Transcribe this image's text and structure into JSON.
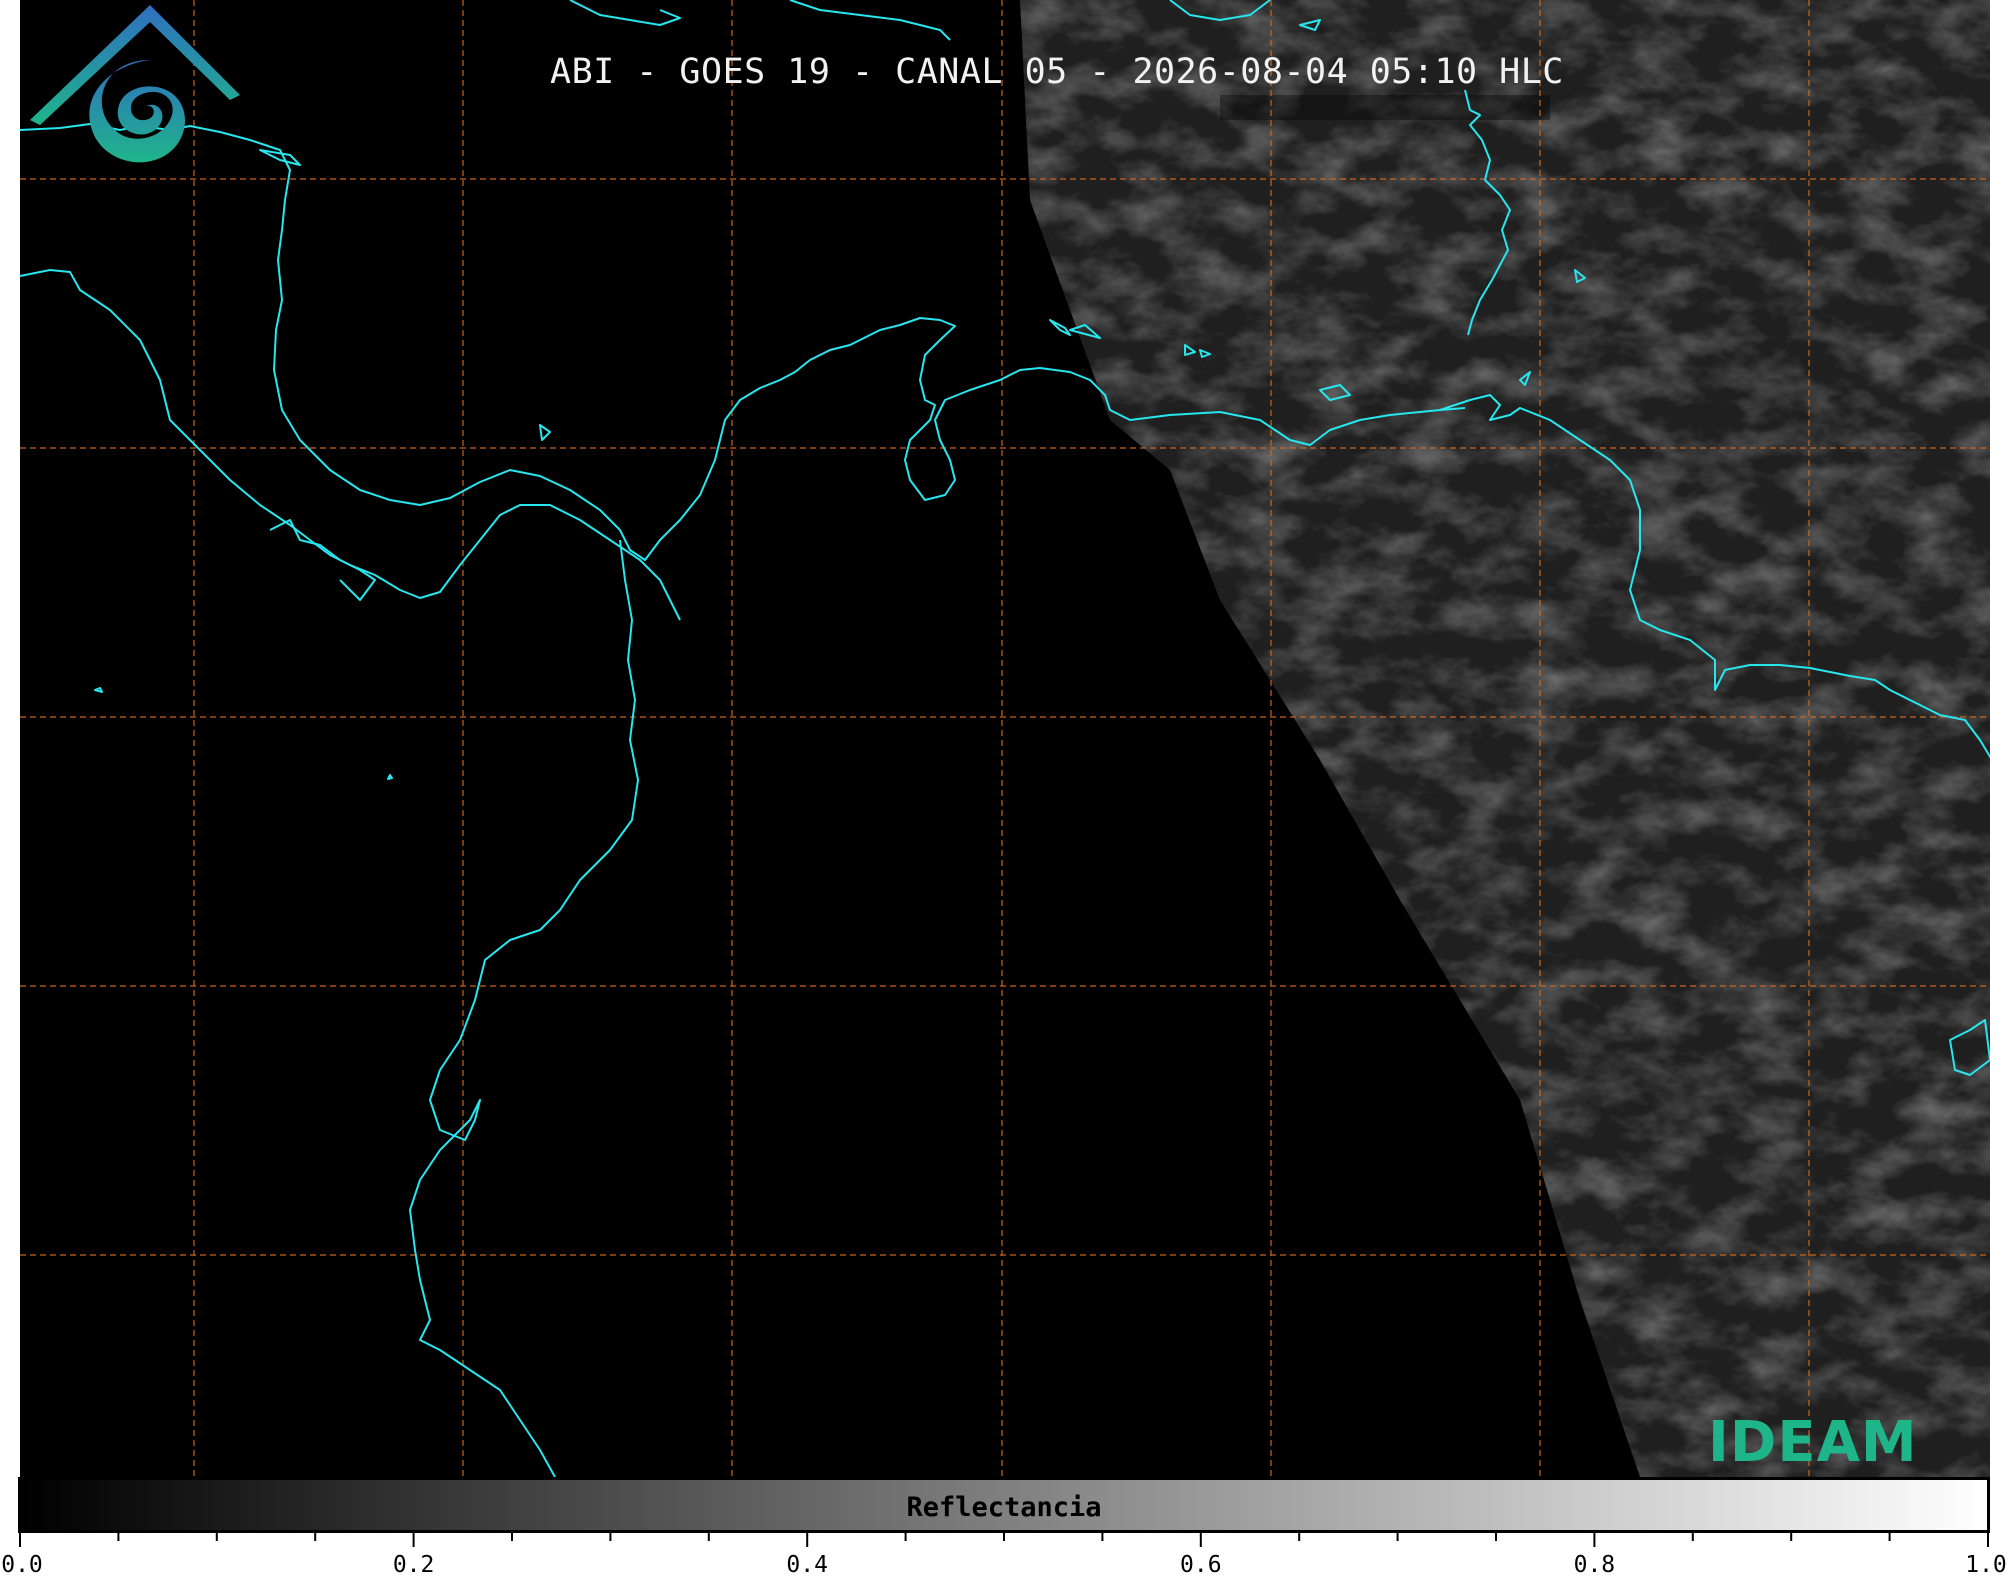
{
  "title": "ABI - GOES 19 - CANAL 05 - 2026-08-04 05:10 HLC",
  "colorbar": {
    "label": "Reflectancia",
    "ticks": [
      "0.0",
      "0.2",
      "0.4",
      "0.6",
      "0.8",
      "1.0"
    ],
    "range": [
      0.0,
      1.0
    ],
    "colormap": [
      "#000000",
      "#ffffff"
    ]
  },
  "logo": {
    "text": "IDEAM",
    "colors": {
      "top": "#2f6fc0",
      "bottom": "#1fb58a"
    }
  },
  "colors": {
    "coastline": "#27e6ee",
    "grid": "#d2691e",
    "background": "#000000"
  }
}
